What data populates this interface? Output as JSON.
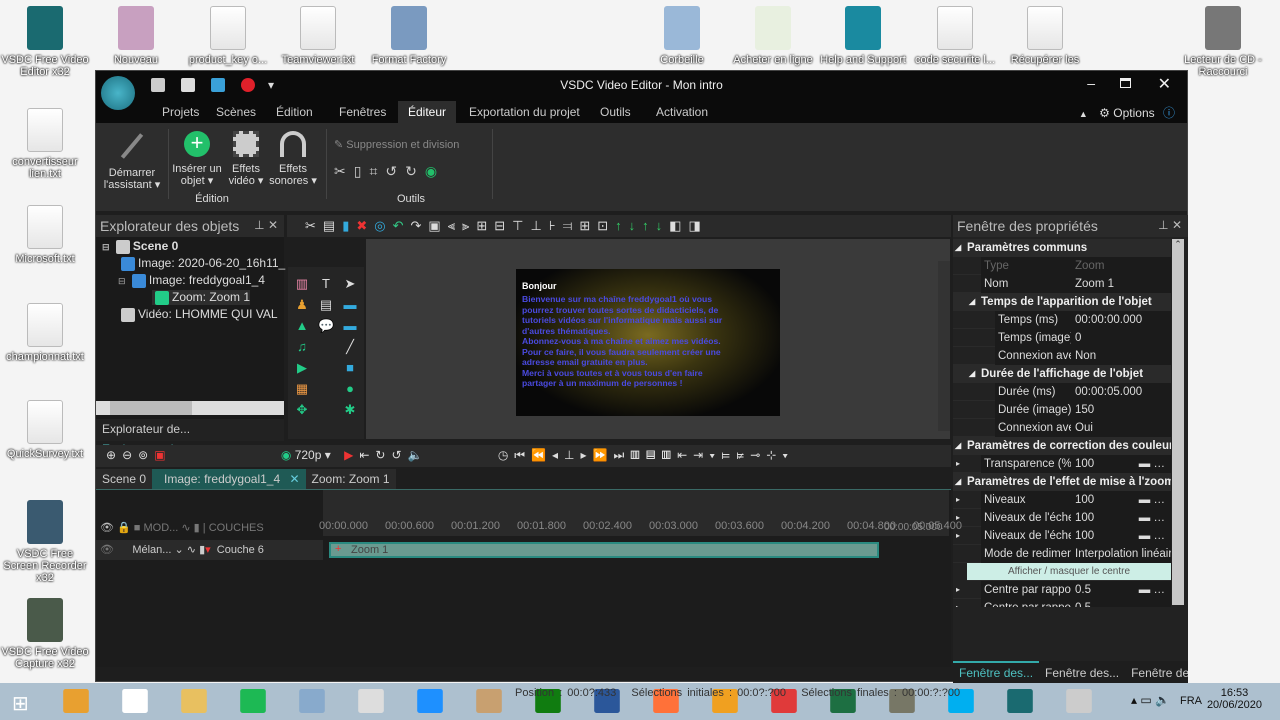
{
  "desktop": {
    "left_icons": [
      "VSDC Free Video Editor x32",
      "convertisseur lien.txt",
      "Microsoft.txt",
      "championnat.txt",
      "QuickSurvey.txt",
      "VSDC Free Screen Recorder x32",
      "VSDC Free Video Capture x32"
    ],
    "top_icons": [
      "Nouveau",
      "product_key o...",
      "Teamviewer.txt",
      "Format Factory",
      "Corbeille",
      "Acheter en ligne",
      "Help and Support",
      "code securite l...",
      "Récupérer les",
      "Lecteur de CD - Raccourci"
    ]
  },
  "window": {
    "title": "VSDC Video Editor - Mon intro",
    "options": "Options"
  },
  "menu": [
    "Projets",
    "Scènes",
    "Édition",
    "Fenêtres",
    "Éditeur",
    "Exportation du projet",
    "Outils",
    "Activation"
  ],
  "ribbon": {
    "assistant": "Démarrer l'assistant",
    "insert": "Insérer un objet",
    "video_effects": "Effets vidéo",
    "audio_effects": "Effets sonores",
    "group_edition": "Édition",
    "split": "Suppression et division",
    "group_tools": "Outils"
  },
  "explorer": {
    "title": "Explorateur des objets",
    "tree": [
      "Scene 0",
      "Image: 2020-06-20_16h11_",
      "Image: freddygoal1_4",
      "Zoom: Zoom 1",
      "Vidéo: LHOMME QUI VAL"
    ],
    "tabs": [
      "Explorateur de...",
      "Explorateur de..."
    ]
  },
  "preview": {
    "heading": "Bonjour",
    "lines": [
      "Bienvenue sur ma chaîne freddygoal1 où vous",
      "pourrez trouver toutes sortes de didacticiels, de",
      "tutoriels vidéos sur l'informatique mais aussi sur",
      "d'autres thématiques.",
      "Abonnez-vous à ma chaîne et aimez mes vidéos.",
      "Pour ce faire, il vous faudra seulement créer une",
      "adresse email gratuite en plus.",
      "Merci à vous toutes et à vous tous d'en faire",
      "partager à un maximum de personnes !"
    ]
  },
  "properties": {
    "title": "Fenêtre des propriétés",
    "rows": [
      {
        "k": "Paramètres communs",
        "sec": 1,
        "lvl": 0
      },
      {
        "k": "Type",
        "v": "Zoom",
        "lvl": 1,
        "dim": 1
      },
      {
        "k": "Nom",
        "v": "Zoom 1",
        "lvl": 1
      },
      {
        "k": "Temps de l'apparition de l'objet",
        "sec": 1,
        "lvl": 1
      },
      {
        "k": "Temps (ms)",
        "v": "00:00:00.000",
        "lvl": 2
      },
      {
        "k": "Temps (image)",
        "v": "0",
        "lvl": 2
      },
      {
        "k": "Connexion avec la",
        "v": "Non",
        "lvl": 2
      },
      {
        "k": "Durée de l'affichage de l'objet",
        "sec": 1,
        "lvl": 1
      },
      {
        "k": "Durée (ms)",
        "v": "00:00:05.000",
        "lvl": 2
      },
      {
        "k": "Durée (image)",
        "v": "150",
        "lvl": 2
      },
      {
        "k": "Connexion avec la",
        "v": "Oui",
        "lvl": 2
      },
      {
        "k": "Paramètres de correction des couleurs",
        "sec": 1,
        "lvl": 0
      },
      {
        "k": "Transparence (%)",
        "v": "100",
        "lvl": 1,
        "slider": 1
      },
      {
        "k": "Paramètres de l'effet de mise à l'zoom",
        "sec": 1,
        "lvl": 0
      },
      {
        "k": "Niveaux",
        "v": "100",
        "lvl": 1,
        "slider": 1
      },
      {
        "k": "Niveaux de l'échelle",
        "v": "100",
        "lvl": 1,
        "slider": 1
      },
      {
        "k": "Niveaux de l'échelle",
        "v": "100",
        "lvl": 1,
        "slider": 1
      },
      {
        "k": "Mode de redimensionnement",
        "v": "Interpolation linéaire",
        "lvl": 1
      },
      {
        "k": "Afficher / masquer le centre",
        "button": 1
      },
      {
        "k": "Centre par rapport à",
        "v": "0.5",
        "lvl": 1,
        "slider": 1
      },
      {
        "k": "Centre par rapport à",
        "v": "0.5",
        "lvl": 1,
        "slider": 1
      }
    ],
    "bottom_tabs": [
      "Fenêtre des...",
      "Fenêtre des...",
      "Fenêtre des..."
    ]
  },
  "timeline": {
    "resolution": "720p",
    "tabs": [
      "Scene 0",
      "Image: freddygoal1_4",
      "Zoom: Zoom 1"
    ],
    "ticks": [
      "00:00.000",
      "00:00.600",
      "00:01.200",
      "00:01.800",
      "00:02.400",
      "00:03.000",
      "00:03.600",
      "00:04.200",
      "00:04.800",
      "00:05.400"
    ],
    "end_marker": "00:00:05.000",
    "header": {
      "mode": "MOD...",
      "layers": "COUCHES"
    },
    "layer": {
      "blend": "Mélan...",
      "name": "Couche 6"
    },
    "clip": "Zoom 1"
  },
  "status": {
    "position": "Position : 00:0?:433",
    "start": "Sélections initiales : 00:0?:?00",
    "end": "Sélections finales : 00:00:?:?00"
  },
  "taskbar": {
    "lang": "FRA",
    "time": "16:53",
    "date": "20/06/2020"
  }
}
